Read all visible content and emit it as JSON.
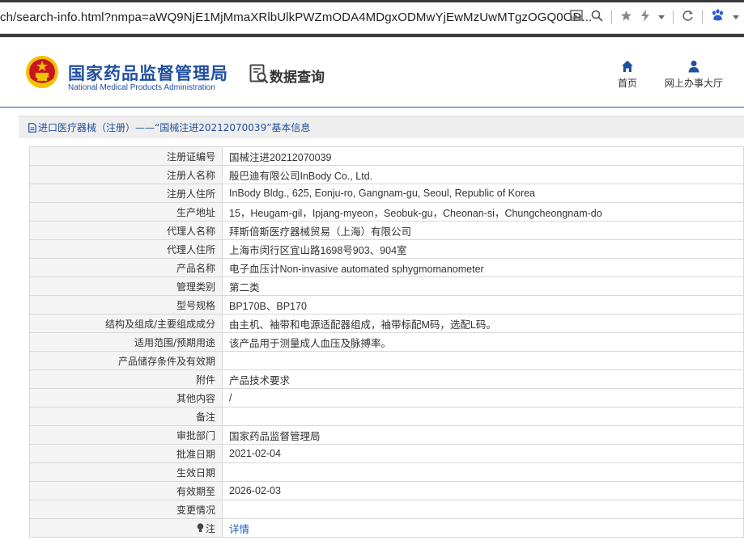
{
  "browser": {
    "url": "ch/search-info.html?nmpa=aWQ9NjE1MjMmaXRlbUlkPWZmODA4MDgxODMwYjEwMzUwMTgzOGQ0OD..."
  },
  "header": {
    "brand_cn": "国家药品监督管理局",
    "brand_en": "National Medical Products Administration",
    "section_title": "数据查询",
    "nav_home": "首页",
    "nav_online": "网上办事大厅"
  },
  "breadcrumb": {
    "text": "进口医疗器械（注册）——“国械注进20212070039”基本信息"
  },
  "rows": [
    {
      "label": "注册证编号",
      "value": "国械注进20212070039"
    },
    {
      "label": "注册人名称",
      "value": "殷巴迪有限公司InBody Co., Ltd."
    },
    {
      "label": "注册人住所",
      "value": "InBody Bldg., 625, Eonju-ro, Gangnam-gu, Seoul, Republic of Korea"
    },
    {
      "label": "生产地址",
      "value": "15，Heugam-gil，Ipjang-myeon，Seobuk-gu，Cheonan-si，Chungcheongnam-do"
    },
    {
      "label": "代理人名称",
      "value": "拜斯倍斯医疗器械贸易（上海）有限公司"
    },
    {
      "label": "代理人住所",
      "value": "上海市闵行区宜山路1698号903、904室"
    },
    {
      "label": "产品名称",
      "value": "电子血压计Non-invasive automated sphygmomanometer"
    },
    {
      "label": "管理类别",
      "value": "第二类"
    },
    {
      "label": "型号规格",
      "value": "BP170B、BP170"
    },
    {
      "label": "结构及组成/主要组成成分",
      "value": "由主机、袖带和电源适配器组成，袖带标配M码，选配L码。"
    },
    {
      "label": "适用范围/预期用途",
      "value": "该产品用于测量成人血压及脉搏率。"
    },
    {
      "label": "产品储存条件及有效期",
      "value": ""
    },
    {
      "label": "附件",
      "value": "产品技术要求"
    },
    {
      "label": "其他内容",
      "value": "/"
    },
    {
      "label": "备注",
      "value": ""
    },
    {
      "label": "审批部门",
      "value": "国家药品监督管理局"
    },
    {
      "label": "批准日期",
      "value": "2021-02-04"
    },
    {
      "label": "生效日期",
      "value": ""
    },
    {
      "label": "有效期至",
      "value": "2026-02-03"
    },
    {
      "label": "变更情况",
      "value": ""
    }
  ],
  "note": {
    "label": "注",
    "link": "详情"
  },
  "colors": {
    "brand_blue": "#1f4fa0",
    "link_blue": "#1f5fbf",
    "emblem_red": "#c8161d",
    "emblem_gold": "#f2c200"
  }
}
